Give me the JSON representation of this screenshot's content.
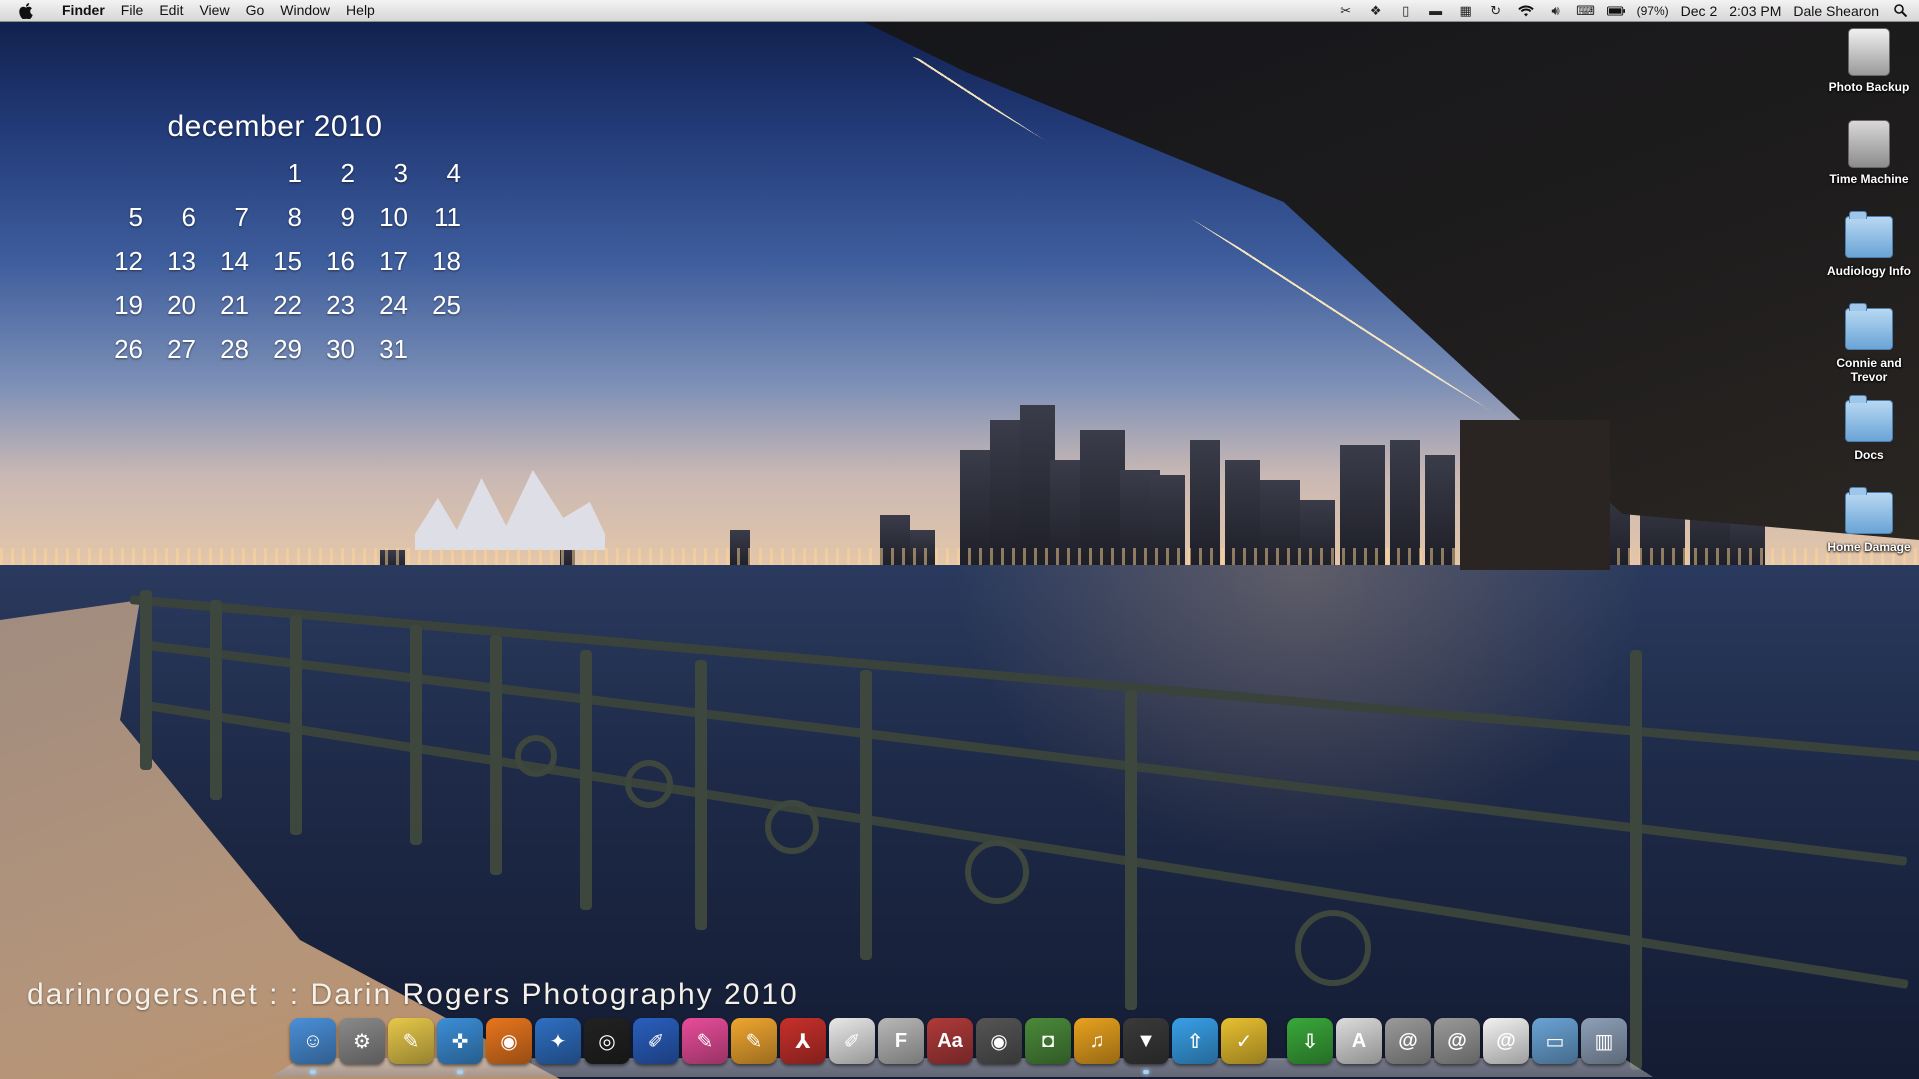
{
  "menubar": {
    "apple_icon": "apple-icon",
    "app_name": "Finder",
    "menus": [
      "File",
      "Edit",
      "View",
      "Go",
      "Window",
      "Help"
    ],
    "status_icons": [
      "scissors-icon",
      "dropbox-icon",
      "document-icon",
      "monitor-icon",
      "grid-icon",
      "time-machine-icon",
      "wifi-icon",
      "volume-icon",
      "keyboard-input-icon",
      "battery-icon"
    ],
    "battery": "(97%)",
    "date": "Dec 2",
    "time": "2:03 PM",
    "user": "Dale Shearon",
    "spotlight_icon": "spotlight-icon"
  },
  "calendar": {
    "title": "december 2010",
    "leading_blanks": 3,
    "days": [
      "1",
      "2",
      "3",
      "4",
      "5",
      "6",
      "7",
      "8",
      "9",
      "10",
      "11",
      "12",
      "13",
      "14",
      "15",
      "16",
      "17",
      "18",
      "19",
      "20",
      "21",
      "22",
      "23",
      "24",
      "25",
      "26",
      "27",
      "28",
      "29",
      "30",
      "31"
    ]
  },
  "desktop_icons": [
    {
      "label": "Photo Backup",
      "kind": "usb-drive-icon"
    },
    {
      "label": "Time Machine",
      "kind": "time-machine-drive-icon"
    },
    {
      "label": "Audiology Info",
      "kind": "folder-icon"
    },
    {
      "label": "Connie and Trevor",
      "kind": "folder-icon"
    },
    {
      "label": "Docs",
      "kind": "folder-icon"
    },
    {
      "label": "Home Damage",
      "kind": "folder-icon"
    }
  ],
  "watermark": "darinrogers.net : : Darin Rogers Photography 2010",
  "dock": {
    "apps": [
      {
        "name": "finder-icon",
        "color": "#4a90d9",
        "glyph": "☺",
        "running": true
      },
      {
        "name": "system-preferences-icon",
        "color": "#8a8a8a",
        "glyph": "⚙",
        "running": false
      },
      {
        "name": "stickies-icon",
        "color": "#e6c84a",
        "glyph": "✎",
        "running": false
      },
      {
        "name": "safari-icon",
        "color": "#3b8fd8",
        "glyph": "✜",
        "running": true
      },
      {
        "name": "firefox-icon",
        "color": "#e8761e",
        "glyph": "◉",
        "running": false
      },
      {
        "name": "network-utility-icon",
        "color": "#2f6fc2",
        "glyph": "✦",
        "running": false
      },
      {
        "name": "aperture-icon",
        "color": "#222222",
        "glyph": "◎",
        "running": false
      },
      {
        "name": "xcode-icon",
        "color": "#2a5fbf",
        "glyph": "✐",
        "running": false
      },
      {
        "name": "sketch-pen-icon",
        "color": "#e84d9a",
        "glyph": "✎",
        "running": false
      },
      {
        "name": "pages-pen-icon",
        "color": "#f0a630",
        "glyph": "✎",
        "running": false
      },
      {
        "name": "acrobat-icon",
        "color": "#c8302b",
        "glyph": "⅄",
        "running": false
      },
      {
        "name": "textedit-icon",
        "color": "#e8e8e8",
        "glyph": "✐",
        "running": false
      },
      {
        "name": "font-book-icon",
        "color": "#b8b8b8",
        "glyph": "F",
        "running": false
      },
      {
        "name": "dictionary-icon",
        "color": "#b03a3a",
        "glyph": "Aa",
        "running": false
      },
      {
        "name": "dvd-player-icon",
        "color": "#555555",
        "glyph": "◉",
        "running": false
      },
      {
        "name": "iphoto-icon",
        "color": "#4b8a3a",
        "glyph": "◘",
        "running": false
      },
      {
        "name": "itunes-icon",
        "color": "#e8a21e",
        "glyph": "♫",
        "running": false
      },
      {
        "name": "tuxedo-icon",
        "color": "#3a3a3a",
        "glyph": "▼",
        "running": true
      },
      {
        "name": "upload-icon",
        "color": "#39a0e8",
        "glyph": "⇧",
        "running": false
      },
      {
        "name": "ticket-icon",
        "color": "#e8c030",
        "glyph": "✓",
        "running": false
      },
      {
        "name": "download-icon",
        "color": "#3aa83a",
        "glyph": "⇩",
        "running": false
      },
      {
        "name": "app-store-icon",
        "color": "#dcdcdc",
        "glyph": "A",
        "running": false
      },
      {
        "name": "mail-stack-icon",
        "color": "#9a9a9a",
        "glyph": "@",
        "running": false
      },
      {
        "name": "mail-stack-2-icon",
        "color": "#9a9a9a",
        "glyph": "@",
        "running": false
      },
      {
        "name": "http-document-icon",
        "color": "#f2f2f2",
        "glyph": "@",
        "running": false
      },
      {
        "name": "documents-folder-icon",
        "color": "#6aa4d6",
        "glyph": "▭",
        "running": false
      },
      {
        "name": "trash-icon",
        "color": "#8ea0b8",
        "glyph": "▥",
        "running": false
      }
    ]
  },
  "colors": {
    "menubar_bg": "#e6e6e6",
    "calendar_text": "#ffffff"
  }
}
